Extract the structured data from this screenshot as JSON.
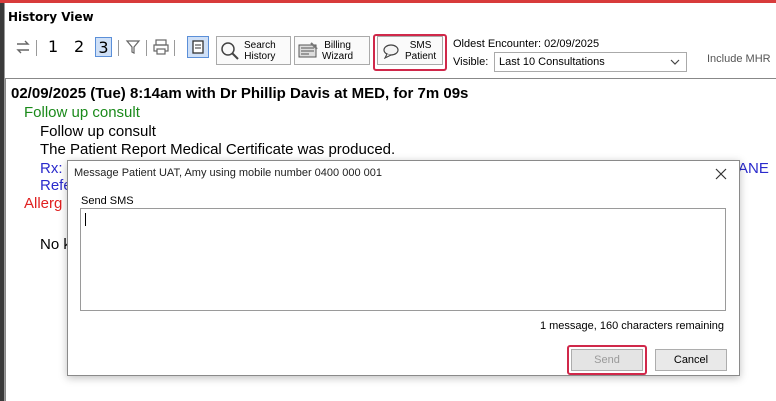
{
  "window": {
    "title": "History View"
  },
  "toolbar": {
    "page_numbers": [
      "1",
      "2",
      "3"
    ],
    "search_history": {
      "line1": "Search",
      "line2": "History"
    },
    "billing_wizard": {
      "line1": "Billing",
      "line2": "Wizard"
    },
    "sms_patient": {
      "line1": "SMS",
      "line2": "Patient"
    },
    "oldest_encounter": "Oldest Encounter: 02/09/2025",
    "visible_label": "Visible:",
    "visible_value": "Last 10 Consultations",
    "include_label": "Include MHR"
  },
  "history": {
    "header": "02/09/2025 (Tue) 8:14am with Dr Phillip Davis at MED, for 7m 09s",
    "section": "Follow up consult",
    "line1": "Follow up consult",
    "line2": "The Patient Report Medical Certificate was produced.",
    "rx": "Rx:",
    "rx_tail": "ANE",
    "ref": "Refe",
    "allergy": "Allerg",
    "nok": "No k"
  },
  "dialog": {
    "title": "Message Patient UAT, Amy using mobile number 0400 000 001",
    "field_label": "Send SMS",
    "message_value": "",
    "status": "1 message, 160 characters remaining",
    "send_label": "Send",
    "cancel_label": "Cancel"
  },
  "colors": {
    "highlight": "#d0284a",
    "accent_top": "#d83b3b",
    "green_text": "#1a8a1a",
    "blue_text": "#2a2acc",
    "red_text": "#e02020"
  }
}
